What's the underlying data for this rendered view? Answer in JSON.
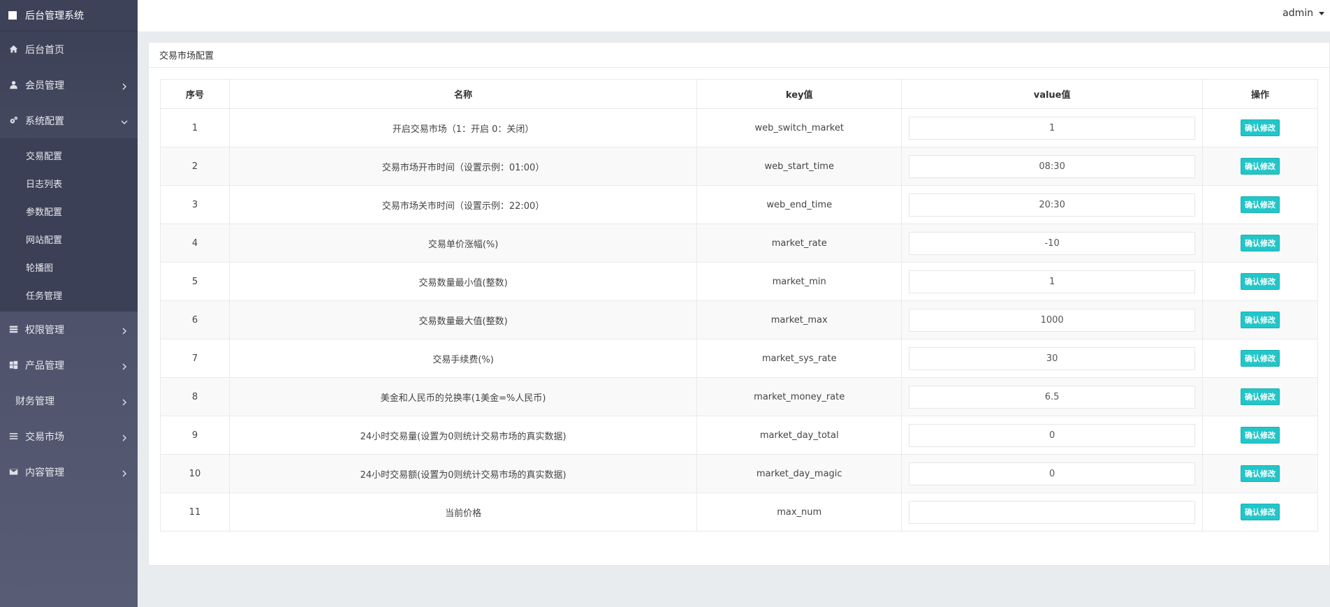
{
  "app": {
    "title": "后台管理系统"
  },
  "header": {
    "user": "admin"
  },
  "sidebar": {
    "items": [
      {
        "label": "后台首页",
        "icon": "home-icon"
      },
      {
        "label": "会员管理",
        "icon": "user-icon"
      },
      {
        "label": "系统配置",
        "icon": "cogs-icon"
      },
      {
        "label": "权限管理",
        "icon": "tasks-icon"
      },
      {
        "label": "产品管理",
        "icon": "windows-icon"
      },
      {
        "label": "财务管理",
        "icon": ""
      },
      {
        "label": "交易市场",
        "icon": "list-icon"
      },
      {
        "label": "内容管理",
        "icon": "envelope-icon"
      }
    ],
    "submenu": [
      "交易配置",
      "日志列表",
      "参数配置",
      "网站配置",
      "轮播图",
      "任务管理"
    ]
  },
  "panel": {
    "title": "交易市场配置"
  },
  "table": {
    "headers": [
      "序号",
      "名称",
      "key值",
      "value值",
      "操作"
    ],
    "button_label": "确认修改",
    "rows": [
      {
        "no": "1",
        "name": "开启交易市场（1：开启 0：关闭）",
        "key": "web_switch_market",
        "value": "1"
      },
      {
        "no": "2",
        "name": "交易市场开市时间（设置示例：01:00）",
        "key": "web_start_time",
        "value": "08:30"
      },
      {
        "no": "3",
        "name": "交易市场关市时间（设置示例：22:00）",
        "key": "web_end_time",
        "value": "20:30"
      },
      {
        "no": "4",
        "name": "交易单价涨幅(%)",
        "key": "market_rate",
        "value": "-10"
      },
      {
        "no": "5",
        "name": "交易数量最小值(整数)",
        "key": "market_min",
        "value": "1"
      },
      {
        "no": "6",
        "name": "交易数量最大值(整数)",
        "key": "market_max",
        "value": "1000"
      },
      {
        "no": "7",
        "name": "交易手续费(%)",
        "key": "market_sys_rate",
        "value": "30"
      },
      {
        "no": "8",
        "name": "美金和人民币的兑换率(1美金=%人民币)",
        "key": "market_money_rate",
        "value": "6.5"
      },
      {
        "no": "9",
        "name": "24小时交易量(设置为0则统计交易市场的真实数据)",
        "key": "market_day_total",
        "value": "0"
      },
      {
        "no": "10",
        "name": "24小时交易额(设置为0则统计交易市场的真实数据)",
        "key": "market_day_magic",
        "value": "0"
      },
      {
        "no": "11",
        "name": "当前价格",
        "key": "max_num",
        "value": ""
      }
    ]
  },
  "colors": {
    "sidebar_bg": "#4b5068",
    "button_bg": "#23c6c8"
  }
}
